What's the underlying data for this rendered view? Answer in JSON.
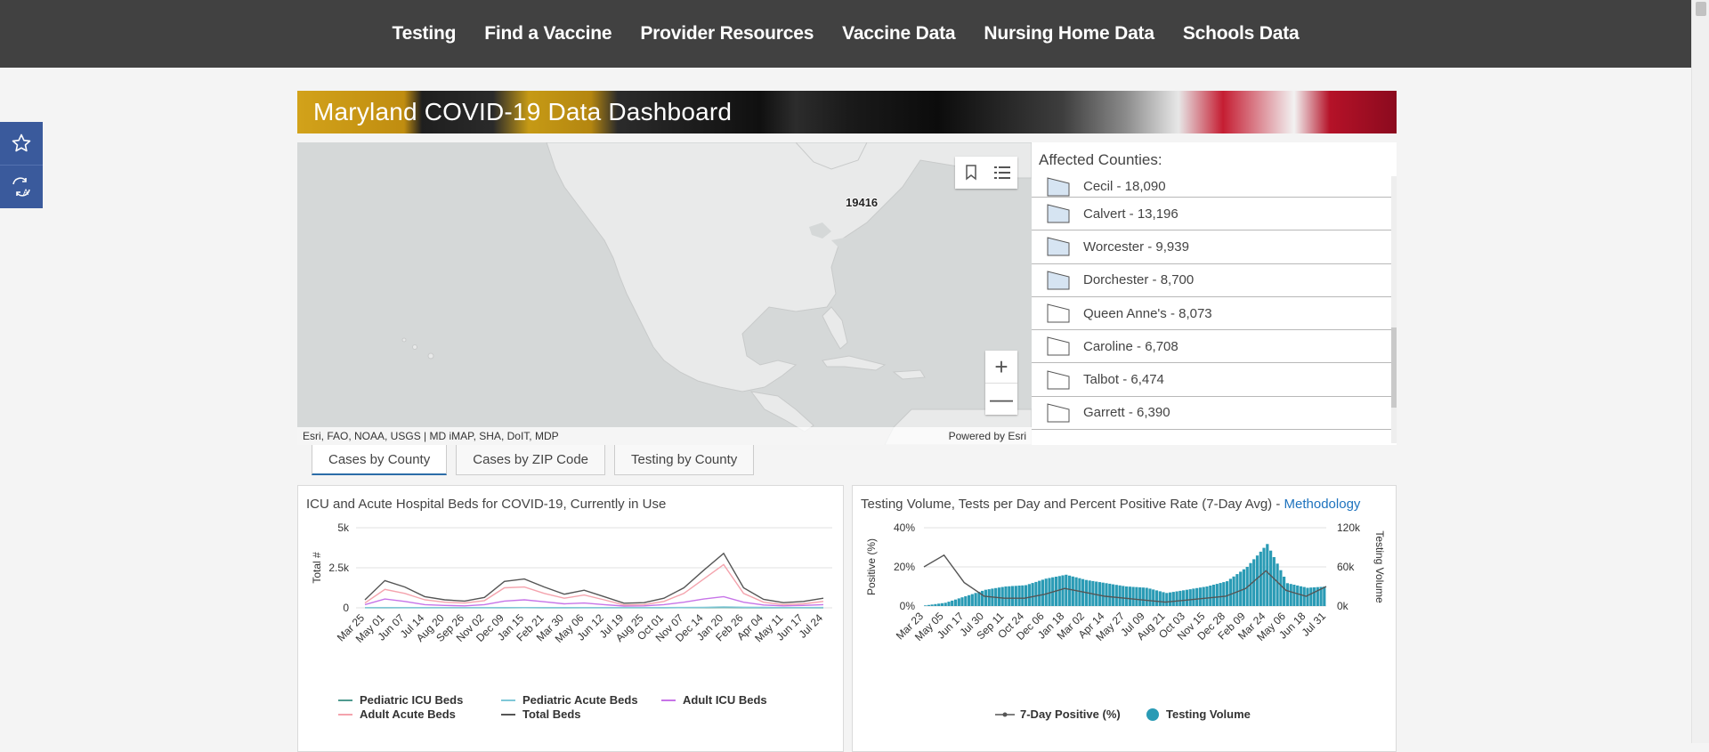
{
  "nav": {
    "items": [
      "Testing",
      "Find a Vaccine",
      "Provider Resources",
      "Vaccine Data",
      "Nursing Home Data",
      "Schools Data"
    ]
  },
  "sidebar_tools": {
    "icons": [
      "star-icon",
      "translate-icon"
    ]
  },
  "banner": {
    "title": "Maryland COVID-19 Data Dashboard"
  },
  "map": {
    "marker_label": "19416",
    "attribution_left": "Esri, FAO, NOAA, USGS | MD iMAP, SHA, DoIT, MDP",
    "attribution_right": "Powered by Esri",
    "zoom_in": "+",
    "zoom_out": "—"
  },
  "counties": {
    "header": "Affected Counties:",
    "items": [
      {
        "label": "Cecil - 18,090",
        "fill": "#d6e4f2"
      },
      {
        "label": "Calvert - 13,196",
        "fill": "#d6e4f2"
      },
      {
        "label": "Worcester - 9,939",
        "fill": "#d6e4f2"
      },
      {
        "label": "Dorchester - 8,700",
        "fill": "#d6e4f2"
      },
      {
        "label": "Queen Anne's - 8,073",
        "fill": "#ffffff"
      },
      {
        "label": "Caroline - 6,708",
        "fill": "#ffffff"
      },
      {
        "label": "Talbot - 6,474",
        "fill": "#ffffff"
      },
      {
        "label": "Garrett - 6,390",
        "fill": "#ffffff"
      }
    ]
  },
  "tabs": {
    "items": [
      "Cases by County",
      "Cases by ZIP Code",
      "Testing by County"
    ],
    "active": 0
  },
  "chart_beds": {
    "title": "ICU and Acute Hospital Beds for COVID-19, Currently in Use"
  },
  "chart_testing": {
    "title": "Testing Volume, Tests per Day and Percent Positive Rate (7-Day Avg) -",
    "link": "Methodology"
  },
  "chart_data": [
    {
      "type": "line",
      "title": "ICU and Acute Hospital Beds for COVID-19, Currently in Use",
      "ylabel": "Total #",
      "yticks": [
        "5k",
        "2.5k",
        "0"
      ],
      "ylim": [
        0,
        5000
      ],
      "x": [
        "Mar 25",
        "May 01",
        "Jun 07",
        "Jul 14",
        "Aug 20",
        "Sep 26",
        "Nov 02",
        "Dec 09",
        "Jan 15",
        "Feb 21",
        "Mar 30",
        "May 06",
        "Jun 12",
        "Jul 19",
        "Aug 25",
        "Oct 01",
        "Nov 07",
        "Dec 14",
        "Jan 20",
        "Feb 26",
        "Apr 04",
        "May 11",
        "Jun 17",
        "Jul 24"
      ],
      "grid": true,
      "legend_position": "bottom",
      "series": [
        {
          "name": "Pediatric ICU Beds",
          "color": "#4f9a8f",
          "values": [
            5,
            8,
            6,
            4,
            4,
            4,
            5,
            7,
            9,
            7,
            6,
            6,
            5,
            4,
            5,
            7,
            9,
            12,
            15,
            10,
            7,
            6,
            6,
            8
          ]
        },
        {
          "name": "Pediatric Acute Beds",
          "color": "#7fc8d8",
          "values": [
            10,
            15,
            12,
            10,
            10,
            10,
            12,
            15,
            18,
            16,
            14,
            12,
            10,
            10,
            12,
            16,
            22,
            35,
            60,
            40,
            25,
            18,
            16,
            20
          ]
        },
        {
          "name": "Adult ICU Beds",
          "color": "#c774e8",
          "values": [
            200,
            550,
            400,
            200,
            150,
            120,
            200,
            420,
            500,
            380,
            250,
            300,
            200,
            110,
            120,
            200,
            350,
            550,
            700,
            350,
            180,
            120,
            150,
            200
          ]
        },
        {
          "name": "Adult Acute Beds",
          "color": "#f4a3ad",
          "values": [
            300,
            1150,
            900,
            500,
            350,
            300,
            450,
            1250,
            1300,
            900,
            600,
            800,
            500,
            180,
            200,
            400,
            900,
            1800,
            2700,
            900,
            350,
            200,
            250,
            400
          ]
        },
        {
          "name": "Total Beds",
          "color": "#555555",
          "values": [
            500,
            1700,
            1300,
            700,
            500,
            420,
            650,
            1650,
            1800,
            1300,
            850,
            1100,
            700,
            290,
            320,
            600,
            1250,
            2350,
            3400,
            1250,
            530,
            320,
            400,
            600
          ]
        }
      ]
    },
    {
      "type": "bar",
      "title": "Testing Volume, Tests per Day and Percent Positive Rate (7-Day Avg) - Methodology",
      "ylabel": "Positive (%)",
      "y2label": "Testing Volume",
      "yticks": [
        "40%",
        "20%",
        "0%"
      ],
      "y2ticks": [
        "120k",
        "60k",
        "0k"
      ],
      "ylim": [
        0,
        40
      ],
      "y2lim": [
        0,
        120000
      ],
      "x": [
        "Mar 23",
        "May 05",
        "Jun 17",
        "Jul 30",
        "Sep 11",
        "Oct 24",
        "Dec 06",
        "Jan 18",
        "Mar 02",
        "Apr 14",
        "May 27",
        "Jul 09",
        "Aug 21",
        "Oct 03",
        "Nov 15",
        "Dec 28",
        "Feb 09",
        "Mar 24",
        "May 06",
        "Jun 18",
        "Jul 31"
      ],
      "legend_position": "bottom",
      "series": [
        {
          "name": "7-Day Positive (%)",
          "color": "#555555",
          "values": [
            20,
            26,
            12,
            5,
            4,
            4,
            6,
            9,
            7,
            5,
            4,
            3,
            2,
            3,
            4,
            5,
            9,
            18,
            8,
            5,
            10
          ]
        },
        {
          "name": "Testing Volume",
          "color": "#2a9bb5",
          "values": [
            1000,
            5000,
            15000,
            25000,
            30000,
            32000,
            42000,
            48000,
            40000,
            35000,
            30000,
            28000,
            20000,
            25000,
            30000,
            38000,
            60000,
            95000,
            35000,
            28000,
            30000
          ]
        }
      ]
    }
  ],
  "colors": {
    "nav_bg": "#414141",
    "accent_blue": "#3a5a9c",
    "link_blue": "#1e73be",
    "testing_bar": "#2a9bb5"
  }
}
